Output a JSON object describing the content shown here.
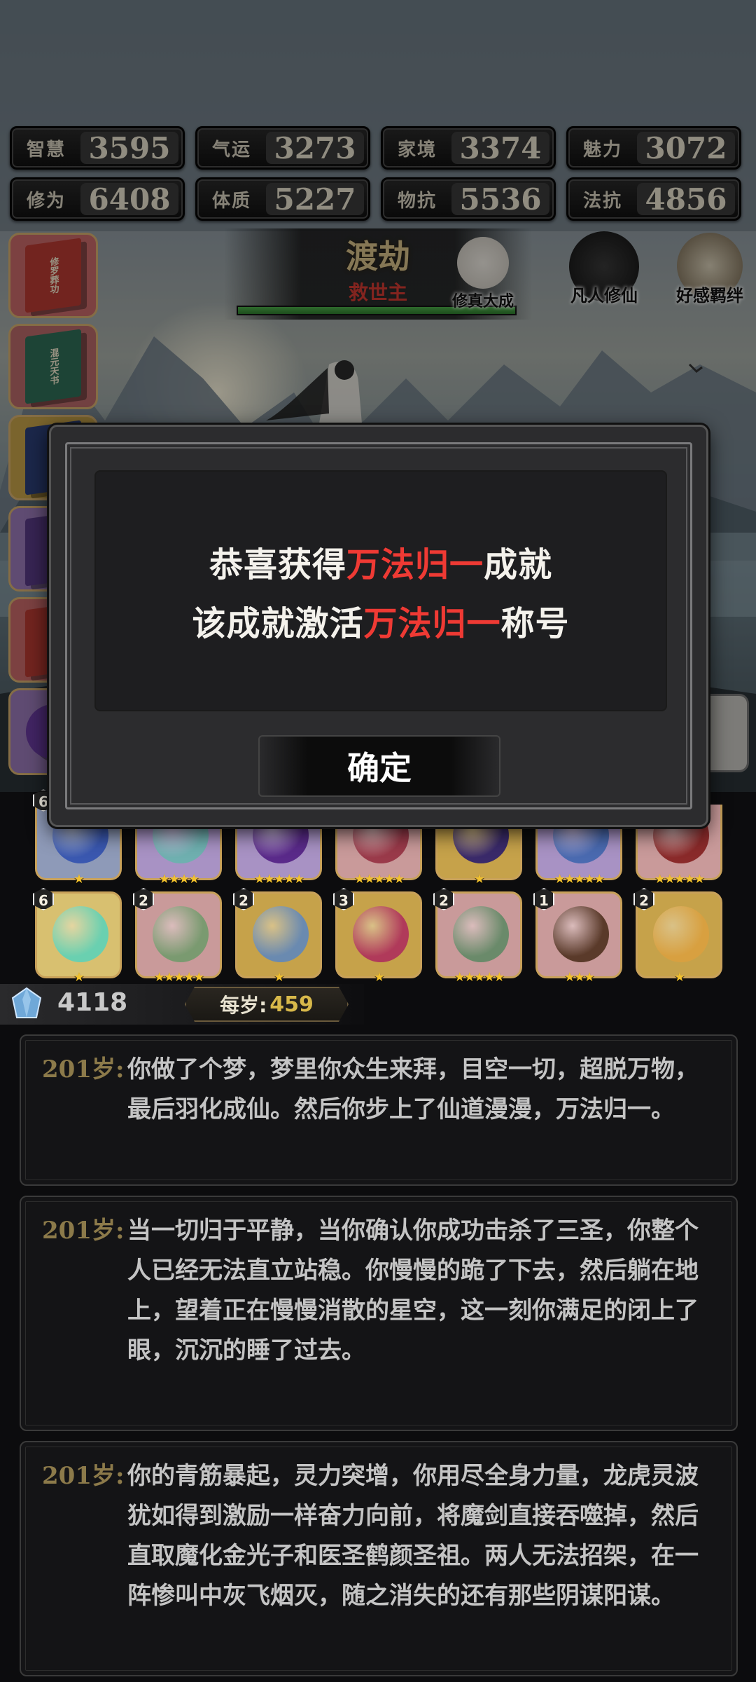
{
  "stats": [
    {
      "label": "智慧",
      "value": "3595"
    },
    {
      "label": "气运",
      "value": "3273"
    },
    {
      "label": "家境",
      "value": "3374"
    },
    {
      "label": "魅力",
      "value": "3072"
    },
    {
      "label": "修为",
      "value": "6408"
    },
    {
      "label": "体质",
      "value": "5227"
    },
    {
      "label": "物抗",
      "value": "5536"
    },
    {
      "label": "法抗",
      "value": "4856"
    }
  ],
  "books": [
    {
      "title": "修罗葬功"
    },
    {
      "title": "混元天书"
    }
  ],
  "realm": {
    "title": "渡劫",
    "subtitle": "救世主",
    "progress": 1.0
  },
  "emblems": {
    "cultivation": "修真大成",
    "mortal": "凡人修仙",
    "affinity": "好感羁绊"
  },
  "items_row1": [
    {
      "count": "6",
      "stars": 1
    },
    {
      "count": "",
      "stars": 4
    },
    {
      "count": "",
      "stars": 5
    },
    {
      "count": "",
      "stars": 5
    },
    {
      "count": "",
      "stars": 1
    },
    {
      "count": "",
      "stars": 5
    },
    {
      "count": "",
      "stars": 5
    }
  ],
  "items_row2": [
    {
      "count": "6",
      "stars": 1
    },
    {
      "count": "2",
      "stars": 5
    },
    {
      "count": "2",
      "stars": 1
    },
    {
      "count": "3",
      "stars": 1
    },
    {
      "count": "2",
      "stars": 5
    },
    {
      "count": "1",
      "stars": 3
    },
    {
      "count": "2",
      "stars": 1
    }
  ],
  "currency": {
    "gems": "4118",
    "per_year_label": "每岁:",
    "per_year_value": "459"
  },
  "logs": [
    {
      "age": "201岁:",
      "text": "你做了个梦，梦里你众生来拜，目空一切，超脱万物，最后羽化成仙。然后你步上了仙道漫漫，万法归一。"
    },
    {
      "age": "201岁:",
      "text": "当一切归于平静，当你确认你成功击杀了三圣，你整个人已经无法直立站稳。你慢慢的跪了下去，然后躺在地上，望着正在慢慢消散的星空，这一刻你满足的闭上了眼，沉沉的睡了过去。"
    },
    {
      "age": "201岁:",
      "text": "你的青筋暴起，灵力突增，你用尽全身力量，龙虎灵波犹如得到激励一样奋力向前，将魔剑直接吞噬掉，然后直取魔化金光子和医圣鹤颜圣祖。两人无法招架，在一阵惨叫中灰飞烟灭，随之消失的还有那些阴谋阳谋。"
    }
  ],
  "modal": {
    "line1_pre": "恭喜获得",
    "line1_highlight": "万法归一",
    "line1_post": "成就",
    "line2_pre": "该成就激活",
    "line2_highlight": "万法归一",
    "line2_post": "称号",
    "confirm_label": "确定",
    "highlight_color": "#ef3a34"
  }
}
